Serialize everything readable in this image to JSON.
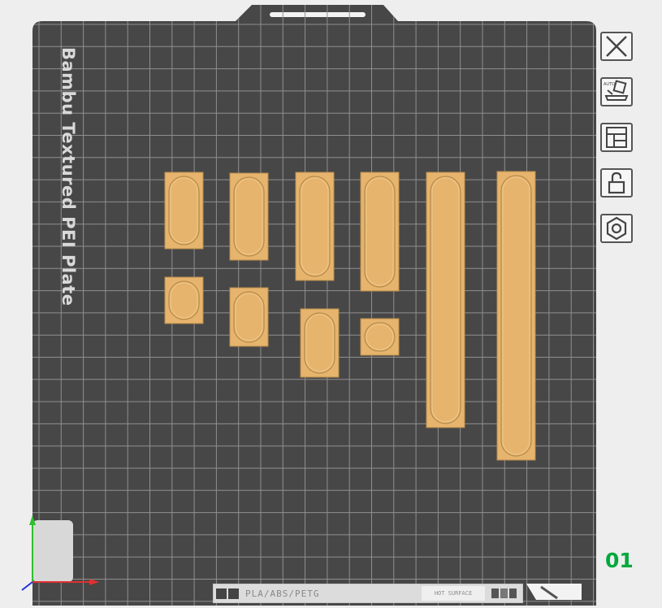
{
  "plate": {
    "name": "Bambu Textured PEI Plate",
    "number": "01",
    "material": "PLA/ABS/PETG",
    "surface_note": "HOT SURFACE",
    "colors": {
      "plate": "#474747",
      "grid": "#8f8f8f",
      "part": "#e6b46d",
      "part_edge": "#b88d4c",
      "label": "#d9d9d9",
      "number": "#00a83c"
    }
  },
  "toolbar": {
    "buttons": [
      {
        "name": "close-plate-button",
        "icon": "close-icon"
      },
      {
        "name": "auto-orient-button",
        "icon": "auto-orient-icon"
      },
      {
        "name": "arrange-button",
        "icon": "arrange-icon"
      },
      {
        "name": "lock-button",
        "icon": "unlock-icon"
      },
      {
        "name": "plate-settings-button",
        "icon": "hexagon-nut-icon"
      }
    ]
  },
  "parts": [
    {
      "name": "part-1",
      "shape": "oval-slot"
    },
    {
      "name": "part-2",
      "shape": "oval-slot"
    },
    {
      "name": "part-3",
      "shape": "oval-slot"
    },
    {
      "name": "part-4",
      "shape": "oval-slot"
    },
    {
      "name": "part-5",
      "shape": "long-slot"
    },
    {
      "name": "part-6",
      "shape": "long-slot"
    },
    {
      "name": "part-7",
      "shape": "oval-slot"
    },
    {
      "name": "part-8",
      "shape": "oval-slot"
    },
    {
      "name": "part-9",
      "shape": "oval-slot"
    },
    {
      "name": "part-10",
      "shape": "round-slot"
    }
  ]
}
